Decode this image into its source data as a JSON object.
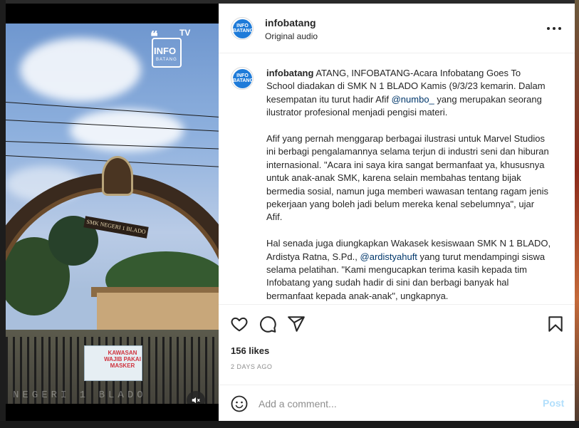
{
  "post": {
    "username": "infobatang",
    "audio": "Original audio",
    "avatar_text": "INFO BATANG",
    "caption_paragraphs": [
      "ATANG, INFOBATANG-Acara Infobatang Goes To School diadakan di SMK N 1 BLADO Kamis (9/3/23 kemarin. Dalam kesempatan itu turut hadir Afif ",
      "Afif yang pernah menggarap berbagai ilustrasi untuk Marvel Studios ini berbagi pengalamannya selama terjun di industri seni dan hiburan internasional. \"Acara ini saya kira sangat bermanfaat ya, khususnya untuk anak-anak SMK, karena selain membahas tentang bijak bermedia sosial, namun juga memberi wawasan tentang ragam jenis pekerjaan yang boleh jadi belum mereka kenal sebelumnya\", ujar Afif.",
      "Hal senada juga diungkapkan Wakasek kesiswaan SMK N 1 BLADO, Ardistya Ratna, S.Pd., ",
      " yang turut mendampingi siswa selama pelatihan. \"Kami mengucapkan terima kasih kepada tim Infobatang yang sudah hadir di sini dan berbagi banyak hal bermanfaat kepada anak-anak\", ungkapnya."
    ],
    "mention_1": "@numbo_",
    "after_mention_1": " yang merupakan seorang ilustrator profesional menjadi pengisi materi.",
    "mention_2": "@ardistyahuft",
    "likes": "156 likes",
    "date": "2 DAYS AGO",
    "comment_placeholder": "Add a comment...",
    "post_label": "Post"
  },
  "media": {
    "watermark_info": "INFO",
    "watermark_batang": "BATANG",
    "watermark_tv": "TV",
    "gate_sign": "SMK NEGERI 1 BLADO",
    "banner_text": "KAWASAN WAJIB PAKAI MASKER",
    "bottom_text": "NEGERI 1 BLADO"
  },
  "colors": {
    "accent": "#0095f6",
    "post_disabled": "#b2dffc",
    "mention": "#00376b"
  },
  "icons": [
    "more-options-icon",
    "heart-icon",
    "comment-icon",
    "share-icon",
    "save-icon",
    "emoji-icon",
    "mute-icon"
  ]
}
